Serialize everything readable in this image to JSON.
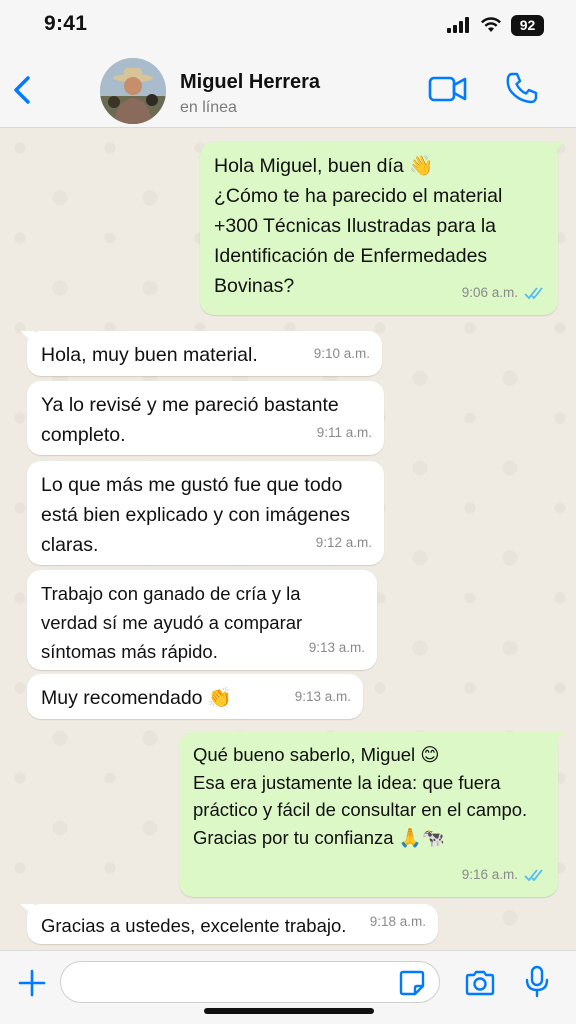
{
  "status_bar": {
    "time": "9:41",
    "battery": "92"
  },
  "header": {
    "contact_name": "Miguel Herrera",
    "contact_status": "en línea"
  },
  "messages": [
    {
      "direction": "out",
      "text": "Hola Miguel, buen día 👋\n¿Cómo te ha parecido el material +300 Técnicas Ilustradas para la Identificación de Enfermedades Bovinas?",
      "time": "9:06 a.m.",
      "read": true
    },
    {
      "direction": "in",
      "text": "Hola, muy buen material.",
      "time": "9:10 a.m."
    },
    {
      "direction": "in",
      "text": "Ya lo revisé y me pareció bastante completo.",
      "time": "9:11 a.m."
    },
    {
      "direction": "in",
      "text": "Lo que más me gustó fue que todo está bien explicado y con imágenes claras.",
      "time": "9:12 a.m."
    },
    {
      "direction": "in",
      "text": "Trabajo con ganado de cría y la verdad sí me ayudó a comparar síntomas más rápido.",
      "time": "9:13 a.m."
    },
    {
      "direction": "in",
      "text": "Muy recomendado 👏",
      "time": "9:13 a.m."
    },
    {
      "direction": "out",
      "text": "Qué bueno saberlo, Miguel 😊\nEsa era justamente la idea: que fuera práctico y fácil de consultar en el campo.\nGracias por tu confianza 🙏🐄",
      "time": "9:16 a.m.",
      "read": true
    },
    {
      "direction": "in",
      "text": "Gracias a ustedes, excelente trabajo.",
      "time": "9:18 a.m."
    }
  ],
  "input_bar": {
    "placeholder": ""
  },
  "colors": {
    "accent": "#007aff",
    "outgoing_bubble": "#dcf8c6",
    "incoming_bubble": "#ffffff",
    "read_ticks": "#53bdeb"
  }
}
